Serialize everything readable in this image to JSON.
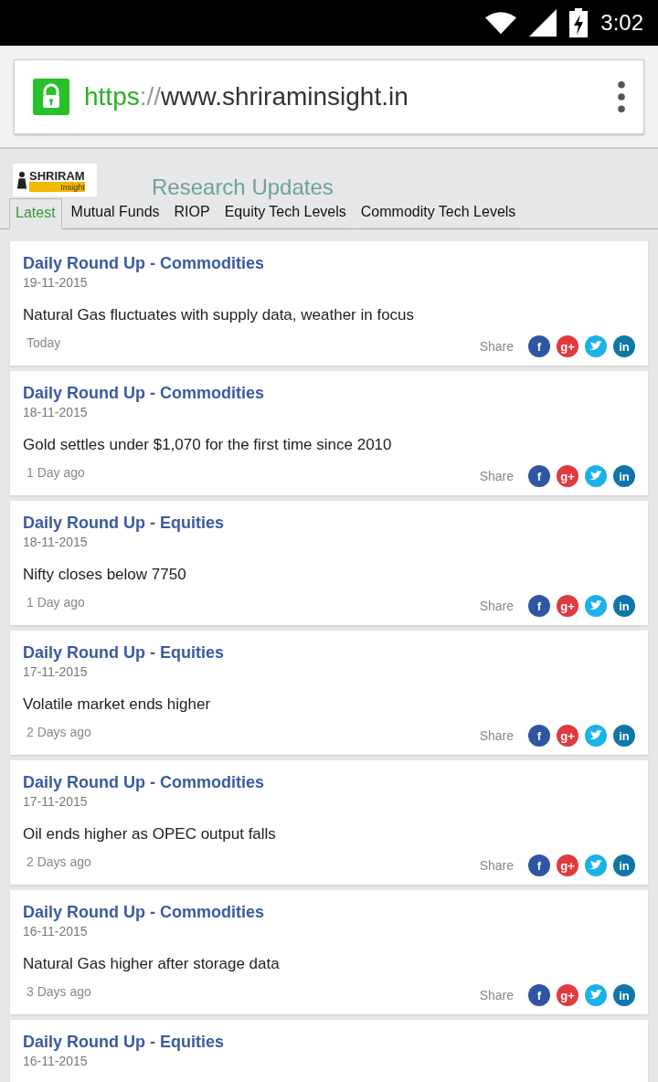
{
  "status_bar": {
    "time": "3:02"
  },
  "browser": {
    "url_scheme": "https",
    "url_separator": "://",
    "url_host": "www.shriraminsight.in"
  },
  "header": {
    "logo_name": "SHRIRAM",
    "logo_tagline": "Insight",
    "title": "Research Updates"
  },
  "tabs": [
    {
      "label": "Latest",
      "selected": true
    },
    {
      "label": "Mutual Funds",
      "selected": false
    },
    {
      "label": "RIOP",
      "selected": false
    },
    {
      "label": "Equity Tech Levels",
      "selected": false
    },
    {
      "label": "Commodity Tech Levels",
      "selected": false
    }
  ],
  "articles": [
    {
      "title": "Daily Round Up - Commodities",
      "date": "19-11-2015",
      "headline": "Natural Gas fluctuates with supply data, weather in focus",
      "age": "Today",
      "share": {
        "label": "Share",
        "icons": [
          {
            "kind": "glyph",
            "glyph": "f",
            "color": "#2f55a4"
          },
          {
            "kind": "glyph",
            "glyph": "g+",
            "color": "#e0393e"
          },
          {
            "kind": "bird",
            "color": "#1ab2e8"
          },
          {
            "kind": "glyph",
            "glyph": "in",
            "color": "#0e76a8"
          }
        ]
      }
    },
    {
      "title": "Daily Round Up - Commodities",
      "date": "18-11-2015",
      "headline": "Gold settles under $1,070 for the first time since 2010",
      "age": "1 Day ago",
      "share": {
        "label": "Share",
        "icons": [
          {
            "kind": "glyph",
            "glyph": "f",
            "color": "#2f55a4"
          },
          {
            "kind": "glyph",
            "glyph": "g+",
            "color": "#e0393e"
          },
          {
            "kind": "bird",
            "color": "#1ab2e8"
          },
          {
            "kind": "glyph",
            "glyph": "in",
            "color": "#0e76a8"
          }
        ]
      }
    },
    {
      "title": "Daily Round Up - Equities",
      "date": "18-11-2015",
      "headline": "Nifty closes below 7750",
      "age": "1 Day ago",
      "share": {
        "label": "Share",
        "icons": [
          {
            "kind": "glyph",
            "glyph": "f",
            "color": "#2f55a4"
          },
          {
            "kind": "glyph",
            "glyph": "g+",
            "color": "#e0393e"
          },
          {
            "kind": "bird",
            "color": "#1ab2e8"
          },
          {
            "kind": "glyph",
            "glyph": "in",
            "color": "#0e76a8"
          }
        ]
      }
    },
    {
      "title": "Daily Round Up - Equities",
      "date": "17-11-2015",
      "headline": "Volatile market ends higher",
      "age": "2 Days ago",
      "share": {
        "label": "Share",
        "icons": [
          {
            "kind": "glyph",
            "glyph": "f",
            "color": "#2f55a4"
          },
          {
            "kind": "glyph",
            "glyph": "g+",
            "color": "#e0393e"
          },
          {
            "kind": "bird",
            "color": "#1ab2e8"
          },
          {
            "kind": "glyph",
            "glyph": "in",
            "color": "#0e76a8"
          }
        ]
      }
    },
    {
      "title": "Daily Round Up - Commodities",
      "date": "17-11-2015",
      "headline": "Oil ends higher as OPEC output falls",
      "age": "2 Days ago",
      "share": {
        "label": "Share",
        "icons": [
          {
            "kind": "glyph",
            "glyph": "f",
            "color": "#2f55a4"
          },
          {
            "kind": "glyph",
            "glyph": "g+",
            "color": "#e0393e"
          },
          {
            "kind": "bird",
            "color": "#1ab2e8"
          },
          {
            "kind": "glyph",
            "glyph": "in",
            "color": "#0e76a8"
          }
        ]
      }
    },
    {
      "title": "Daily Round Up - Commodities",
      "date": "16-11-2015",
      "headline": "Natural Gas higher after storage data",
      "age": "3 Days ago",
      "share": {
        "label": "Share",
        "icons": [
          {
            "kind": "glyph",
            "glyph": "f",
            "color": "#2f55a4"
          },
          {
            "kind": "glyph",
            "glyph": "g+",
            "color": "#e0393e"
          },
          {
            "kind": "bird",
            "color": "#1ab2e8"
          },
          {
            "kind": "glyph",
            "glyph": "in",
            "color": "#0e76a8"
          }
        ]
      }
    },
    {
      "title": "Daily Round Up - Equities",
      "date": "16-11-2015"
    }
  ]
}
